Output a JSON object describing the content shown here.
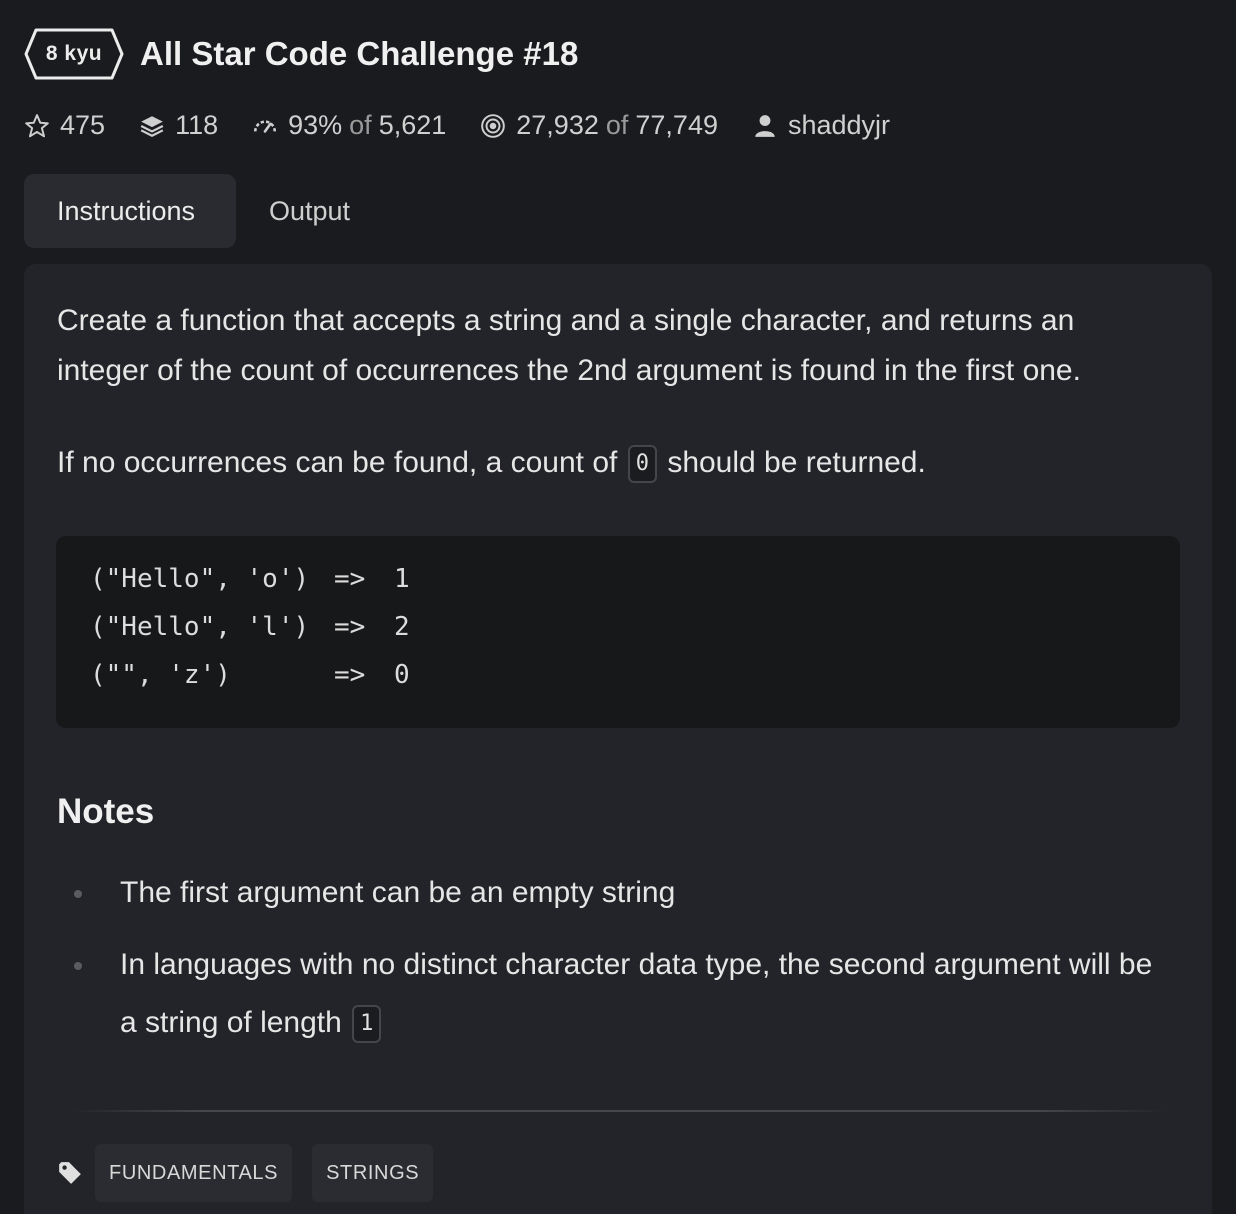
{
  "kata": {
    "rank": "8 kyu",
    "title": "All Star Code Challenge #18"
  },
  "stats": {
    "stars": "475",
    "collections": "118",
    "satisfaction_pct": "93%",
    "satisfaction_of": "of",
    "satisfaction_votes": "5,621",
    "completed": "27,932",
    "completed_of": "of",
    "attempted": "77,749",
    "author": "shaddyjr"
  },
  "tabs": [
    {
      "label": "Instructions",
      "active": true
    },
    {
      "label": "Output",
      "active": false
    }
  ],
  "instructions": {
    "paragraph1": "Create a function that accepts a string and a single character, and returns an integer of the count of occurrences the 2nd argument is found in the first one.",
    "paragraph2_before": "If no occurrences can be found, a count of",
    "paragraph2_code": "0",
    "paragraph2_after": "should be returned.",
    "examples": [
      {
        "input": "(\"Hello\", 'o')",
        "arrow": "=>",
        "result": "1"
      },
      {
        "input": "(\"Hello\", 'l')",
        "arrow": "=>",
        "result": "2"
      },
      {
        "input": "(\"\", 'z')",
        "arrow": "=>",
        "result": "0"
      }
    ],
    "notes_title": "Notes",
    "notes": [
      {
        "text": "The first argument can be an empty string"
      },
      {
        "text": "In languages with no distinct character data type, the second argument will be a string of length",
        "code": "1"
      }
    ]
  },
  "tags": [
    "FUNDAMENTALS",
    "STRINGS"
  ],
  "colors": {
    "background": "#1a1b1e",
    "panel": "#232429",
    "code_block": "#17181a",
    "text": "#e6e6e6"
  }
}
